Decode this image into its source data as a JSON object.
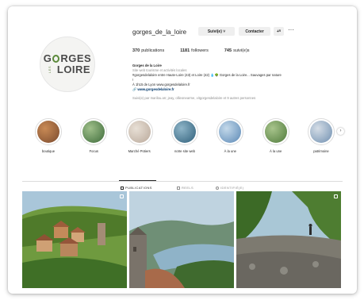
{
  "profile": {
    "username": "gorges_de_la_loire",
    "logo_word_1": "G",
    "logo_word_1b": "RGES",
    "logo_small": "LES",
    "logo_word_2": "LOIRE",
    "buttons": {
      "follow": "Suivi(e) ˅",
      "contact": "Contacter",
      "add_user": "+ᴿ",
      "more": "···"
    },
    "stats": {
      "posts_count": "370",
      "posts_label": "publications",
      "followers_count": "1181",
      "followers_label": "followers",
      "following_count": "745",
      "following_label": "suivi(e)s"
    },
    "bio": {
      "name": "Gorges de la Loire",
      "category": "Site web tourisme et activités locales",
      "line1": "#gorgesdelaloire entre Haute-Loire (43) et Loire (42) 💧🌳 Gorges de la Loire... Sauvages par nature",
      "line2": "!",
      "line3": "À 1h15 de Lyon www.gorgesdelaloire.fr",
      "link": "🔗 www.gorgesdelaloire.fr",
      "followed_by": "Suivi(e) par marilou.arr, jeay, ollieonearme, vitgorgesdelaloire et 9 autres personnes"
    }
  },
  "highlights": [
    {
      "label": "boutique",
      "color_a": "#7a4a2e",
      "color_b": "#c98a55"
    },
    {
      "label": "Focus",
      "color_a": "#3d6b3a",
      "color_b": "#9fbf8a"
    },
    {
      "label": "Marché Potiers",
      "color_a": "#b9a89a",
      "color_b": "#e8e0d6"
    },
    {
      "label": "notre site web",
      "color_a": "#2f5f7a",
      "color_b": "#8fb5c8"
    },
    {
      "label": "À la une",
      "color_a": "#5a88b5",
      "color_b": "#c4d9ea"
    },
    {
      "label": "À la une",
      "color_a": "#4f7a3b",
      "color_b": "#a8c48c"
    },
    {
      "label": "patrimoine",
      "color_a": "#6f8fb0",
      "color_b": "#d5dde6"
    }
  ],
  "tabs": [
    {
      "label": "PUBLICATIONS",
      "icon": "grid-icon"
    },
    {
      "label": "REELS",
      "icon": "reels-icon"
    },
    {
      "label": "IDENTIFIÉ(E)",
      "icon": "tagged-icon"
    }
  ],
  "posts": [
    {
      "alt": "village",
      "colors": [
        "#6a8f3c",
        "#a4693e",
        "#d2b38d"
      ]
    },
    {
      "alt": "gorges",
      "colors": [
        "#7f9cb3",
        "#4d6e3c",
        "#6e6a63"
      ]
    },
    {
      "alt": "forest",
      "colors": [
        "#3e6a2a",
        "#98b56b",
        "#7d7b72"
      ]
    }
  ]
}
